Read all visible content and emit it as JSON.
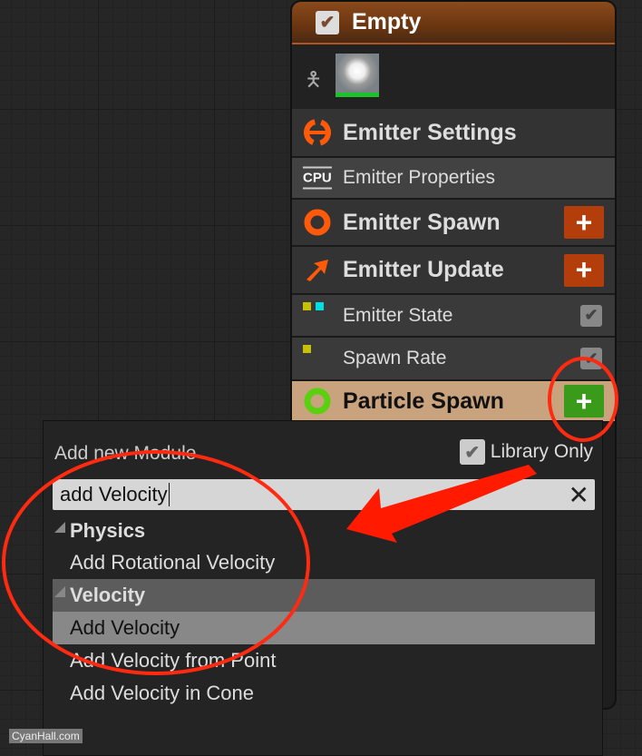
{
  "node": {
    "title": "Empty",
    "enabled": true,
    "rows": [
      {
        "label": "Emitter Settings",
        "icon": "emitter-settings-icon"
      },
      {
        "label": "Emitter Properties",
        "icon": "cpu-icon",
        "icon_text": "CPU"
      },
      {
        "label": "Emitter Spawn",
        "icon": "ring-icon",
        "add": "+"
      },
      {
        "label": "Emitter Update",
        "icon": "arrow-up-right-icon",
        "add": "+"
      },
      {
        "label": "Emitter State",
        "checked": true
      },
      {
        "label": "Spawn Rate",
        "checked": true
      },
      {
        "label": "Particle Spawn",
        "icon": "ring-icon",
        "add": "+"
      }
    ]
  },
  "popup": {
    "title": "Add new Module",
    "library_only_label": "Library Only",
    "library_only": true,
    "search_value": "add Velocity",
    "categories": [
      {
        "name": "Physics",
        "items": [
          "Add Rotational Velocity"
        ]
      },
      {
        "name": "Velocity",
        "items": [
          "Add Velocity",
          "Add Velocity from Point",
          "Add Velocity in Cone"
        ]
      }
    ],
    "selected": "Add Velocity"
  },
  "watermark": "CyanHall.com",
  "colors": {
    "accent_orange": "#ff5a0a",
    "add_button": "#b33e0c",
    "particle_add": "#3a9a1a",
    "particle_row": "#c9a27e",
    "annotation": "#ff2a10"
  }
}
